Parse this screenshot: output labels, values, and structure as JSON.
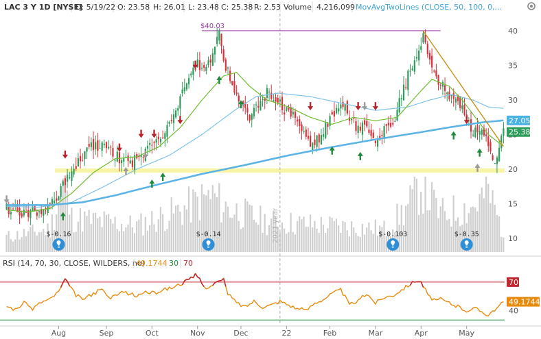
{
  "header": {
    "symbol": "LAC 3 Y 1D [NYSE]",
    "date": "D: 5/19/22",
    "open": "O: 23.58",
    "high": "H: 26.01",
    "low": "L: 23.48",
    "close": "C: 25.38",
    "range": "R: 2.53",
    "volume_label": "Volume",
    "volume_value": "4,216,099",
    "study": "MovAvgTwoLines (CLOSE, 50, 100, 0,..."
  },
  "rsi_header": {
    "label": "RSI (14, 70, 30, CLOSE, WILDERS, no)",
    "value": "49.1744",
    "lower": "30",
    "upper": "70"
  },
  "annotations": {
    "high_label": "$40.03",
    "year_label": "2021 year",
    "earnings": [
      "$-0.16",
      "$-0.14",
      "$-0.103",
      "$-0.35"
    ]
  },
  "colors": {
    "up": "#2e9c5a",
    "down": "#d9323a",
    "ma50": "#6ebd2e",
    "ma100": "#7fc2e8",
    "ma200": "#5bb3e6",
    "trend": "#c6921c",
    "rsi": "#e88b0c",
    "volume": "#cfcfcf",
    "support": "#f6f49a",
    "hline": "#9b3ba5",
    "earnings": "#2f8fd6",
    "rsi_ob": "#c0282f",
    "price_tag_ma": "#4ab3e3",
    "price_tag_close": "#2e9c5a",
    "rsi_tag": "#e88b0c",
    "rsi70_tag": "#c0282f"
  },
  "chart_data": [
    {
      "type": "candlestick",
      "title": "LAC 3 Y 1D [NYSE]",
      "x_tick_labels": [
        "Aug",
        "Sep",
        "Oct",
        "Nov",
        "Dec",
        "22",
        "Feb",
        "Mar",
        "Apr",
        "May"
      ],
      "y_tick_labels": [
        "10",
        "15",
        "20",
        "25",
        "30",
        "35",
        "40"
      ],
      "ylim": [
        8,
        42.5
      ],
      "y_scale": "linear",
      "grid": false,
      "close_path": [
        [
          0,
          14.3
        ],
        [
          6,
          13.8
        ],
        [
          12,
          13.9
        ],
        [
          18,
          14.2
        ],
        [
          22,
          15.2
        ],
        [
          26,
          17.5
        ],
        [
          30,
          19.5
        ],
        [
          34,
          21.5
        ],
        [
          40,
          23.5
        ],
        [
          46,
          23.0
        ],
        [
          52,
          21.5
        ],
        [
          58,
          21.0
        ],
        [
          64,
          22.5
        ],
        [
          70,
          24.2
        ],
        [
          76,
          26.5
        ],
        [
          80,
          30
        ],
        [
          84,
          33
        ],
        [
          88,
          35.5
        ],
        [
          92,
          34
        ],
        [
          95,
          37
        ],
        [
          98,
          39.5
        ],
        [
          100,
          36
        ],
        [
          104,
          32
        ],
        [
          108,
          29.5
        ],
        [
          112,
          27.5
        ],
        [
          116,
          29
        ],
        [
          120,
          31
        ],
        [
          124,
          30.5
        ],
        [
          128,
          28.5
        ],
        [
          132,
          27.5
        ],
        [
          136,
          25.5
        ],
        [
          140,
          23.5
        ],
        [
          144,
          24.5
        ],
        [
          148,
          26.5
        ],
        [
          152,
          28.5
        ],
        [
          154,
          30
        ],
        [
          158,
          27.5
        ],
        [
          162,
          25.5
        ],
        [
          166,
          26.5
        ],
        [
          170,
          24
        ],
        [
          174,
          25.5
        ],
        [
          178,
          26.5
        ],
        [
          182,
          30.5
        ],
        [
          186,
          34.5
        ],
        [
          188,
          35.5
        ],
        [
          190,
          37.5
        ],
        [
          192,
          39.5
        ],
        [
          194,
          36
        ],
        [
          198,
          33
        ],
        [
          202,
          31.5
        ],
        [
          206,
          30
        ],
        [
          210,
          28.5
        ],
        [
          214,
          25.5
        ],
        [
          218,
          26
        ],
        [
          221,
          24.5
        ],
        [
          223,
          22
        ],
        [
          225,
          21.5
        ],
        [
          227,
          23
        ],
        [
          229,
          25.2
        ]
      ],
      "ma_50_path": [
        [
          0,
          14.1
        ],
        [
          10,
          13.8
        ],
        [
          20,
          14.3
        ],
        [
          30,
          16.5
        ],
        [
          40,
          19.5
        ],
        [
          50,
          21.5
        ],
        [
          60,
          21.8
        ],
        [
          70,
          23.2
        ],
        [
          80,
          26
        ],
        [
          90,
          30
        ],
        [
          100,
          33.5
        ],
        [
          106,
          34
        ],
        [
          112,
          32
        ],
        [
          120,
          30
        ],
        [
          130,
          29
        ],
        [
          140,
          27.5
        ],
        [
          150,
          26.5
        ],
        [
          160,
          27.5
        ],
        [
          170,
          27
        ],
        [
          180,
          27.5
        ],
        [
          190,
          31
        ],
        [
          196,
          33
        ],
        [
          204,
          32
        ],
        [
          210,
          30
        ],
        [
          216,
          27.5
        ],
        [
          222,
          25
        ],
        [
          229,
          23.3
        ]
      ],
      "ma_100_path": [
        [
          0,
          14.6
        ],
        [
          15,
          14.5
        ],
        [
          30,
          15.2
        ],
        [
          45,
          17.5
        ],
        [
          60,
          20
        ],
        [
          75,
          22
        ],
        [
          90,
          25
        ],
        [
          105,
          28.5
        ],
        [
          115,
          30.5
        ],
        [
          125,
          31
        ],
        [
          140,
          30.5
        ],
        [
          155,
          29.5
        ],
        [
          170,
          28.5
        ],
        [
          185,
          29
        ],
        [
          195,
          30
        ],
        [
          205,
          30.8
        ],
        [
          215,
          30
        ],
        [
          222,
          29
        ],
        [
          229,
          28.8
        ]
      ],
      "ma_200_path": [
        [
          0,
          14.8
        ],
        [
          20,
          14.8
        ],
        [
          35,
          15.2
        ],
        [
          50,
          16.2
        ],
        [
          70,
          17.8
        ],
        [
          90,
          19.3
        ],
        [
          110,
          20.6
        ],
        [
          130,
          22
        ],
        [
          150,
          23.2
        ],
        [
          170,
          24.3
        ],
        [
          190,
          25.3
        ],
        [
          205,
          26.1
        ],
        [
          220,
          26.8
        ],
        [
          229,
          27.05
        ]
      ],
      "volume_path": [
        [
          0,
          0.2
        ],
        [
          20,
          0.3
        ],
        [
          26,
          0.9
        ],
        [
          30,
          0.45
        ],
        [
          60,
          0.35
        ],
        [
          80,
          0.55
        ],
        [
          95,
          0.75
        ],
        [
          100,
          0.6
        ],
        [
          120,
          0.4
        ],
        [
          150,
          0.35
        ],
        [
          175,
          0.3
        ],
        [
          185,
          0.6
        ],
        [
          191,
          0.9
        ],
        [
          200,
          0.5
        ],
        [
          215,
          0.6
        ],
        [
          222,
          0.8
        ],
        [
          229,
          0.25
        ]
      ],
      "swing_high": {
        "x": 98,
        "y": 40.03
      },
      "april_high_x": 192,
      "support_level": 19.8,
      "trendline": [
        [
          192,
          40
        ],
        [
          229,
          23.3
        ]
      ],
      "last_values": {
        "ma": 27.05,
        "close": 25.38
      },
      "up_arrows": [
        [
          26,
          12.8
        ],
        [
          67,
          17.5
        ],
        [
          72,
          18.5
        ],
        [
          98,
          32.5
        ],
        [
          108,
          29
        ],
        [
          150,
          22.3
        ],
        [
          163,
          21.5
        ],
        [
          206,
          24.5
        ],
        [
          218,
          22
        ]
      ],
      "down_arrows": [
        [
          27,
          22.5
        ],
        [
          52,
          23.5
        ],
        [
          62,
          25.5
        ],
        [
          68,
          25.5
        ],
        [
          80,
          27.5
        ],
        [
          87,
          35.5
        ],
        [
          140,
          29.5
        ],
        [
          162,
          29.5
        ],
        [
          170,
          29.5
        ],
        [
          212,
          27.5
        ]
      ],
      "gray_up_arrows": [
        [
          55,
          19.3
        ],
        [
          217,
          19.8
        ]
      ],
      "gray_down_arrows": [
        [
          0,
          16
        ],
        [
          64,
          22.5
        ],
        [
          165,
          29.5
        ]
      ],
      "earnings_x": [
        24,
        93,
        178,
        212
      ],
      "separator_x": 126,
      "month_x": [
        24,
        46,
        67,
        88,
        108,
        129,
        149,
        170,
        191,
        212
      ]
    },
    {
      "type": "line",
      "title": "RSI (14, 70, 30, CLOSE, WILDERS, no)",
      "y_tick_labels": [
        "40",
        "70"
      ],
      "ylim": [
        28,
        80
      ],
      "levels": [
        30,
        70
      ],
      "current_value": 49.1744,
      "rsi_path": [
        [
          0,
          45
        ],
        [
          4,
          41
        ],
        [
          8,
          48
        ],
        [
          12,
          42
        ],
        [
          16,
          49
        ],
        [
          20,
          52
        ],
        [
          24,
          60
        ],
        [
          27,
          72
        ],
        [
          29,
          66
        ],
        [
          32,
          56
        ],
        [
          36,
          52
        ],
        [
          40,
          58
        ],
        [
          44,
          62
        ],
        [
          48,
          52
        ],
        [
          52,
          60
        ],
        [
          56,
          58
        ],
        [
          60,
          55
        ],
        [
          64,
          60
        ],
        [
          68,
          58
        ],
        [
          72,
          62
        ],
        [
          76,
          64
        ],
        [
          80,
          68
        ],
        [
          84,
          72
        ],
        [
          87,
          77
        ],
        [
          89,
          74
        ],
        [
          91,
          64
        ],
        [
          94,
          66
        ],
        [
          97,
          70
        ],
        [
          100,
          72
        ],
        [
          102,
          58
        ],
        [
          106,
          48
        ],
        [
          110,
          44
        ],
        [
          114,
          50
        ],
        [
          118,
          44
        ],
        [
          122,
          46
        ],
        [
          126,
          50
        ],
        [
          130,
          46
        ],
        [
          134,
          42
        ],
        [
          138,
          40
        ],
        [
          142,
          48
        ],
        [
          146,
          52
        ],
        [
          150,
          58
        ],
        [
          154,
          62
        ],
        [
          158,
          46
        ],
        [
          162,
          50
        ],
        [
          166,
          58
        ],
        [
          170,
          48
        ],
        [
          174,
          54
        ],
        [
          178,
          56
        ],
        [
          182,
          62
        ],
        [
          186,
          68
        ],
        [
          189,
          72
        ],
        [
          191,
          70
        ],
        [
          193,
          62
        ],
        [
          196,
          50
        ],
        [
          200,
          52
        ],
        [
          204,
          48
        ],
        [
          208,
          44
        ],
        [
          212,
          40
        ],
        [
          216,
          42
        ],
        [
          220,
          38
        ],
        [
          222,
          35
        ],
        [
          224,
          40
        ],
        [
          227,
          44
        ],
        [
          229,
          49.17
        ]
      ]
    }
  ]
}
